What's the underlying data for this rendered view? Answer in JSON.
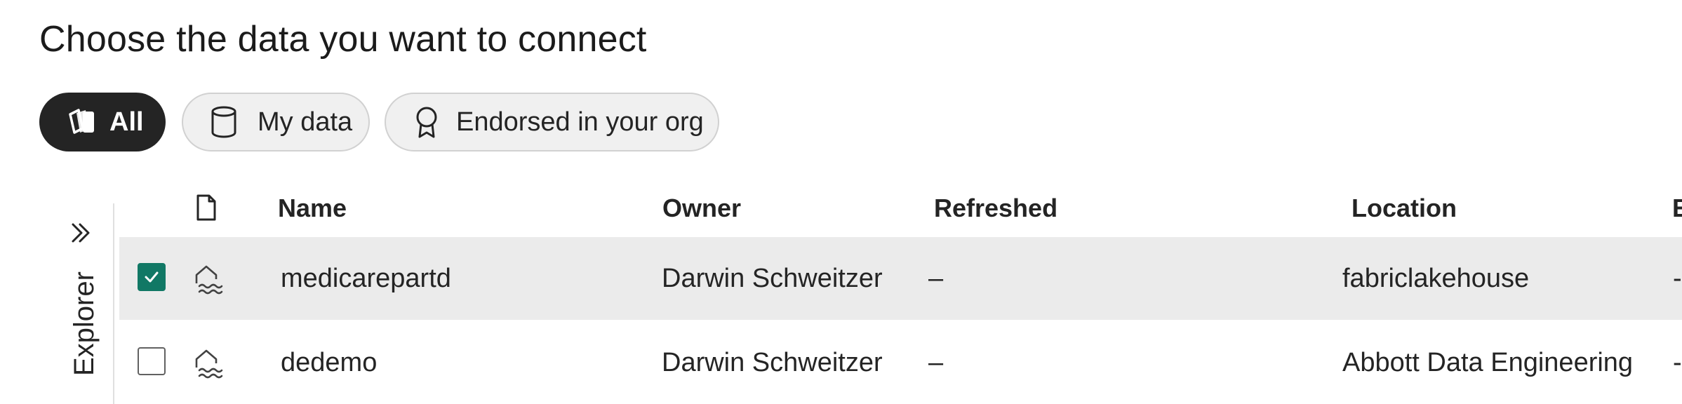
{
  "page": {
    "title": "Choose the data you want to connect"
  },
  "filters": [
    {
      "label": "All",
      "icon": "all-items-icon",
      "active": true
    },
    {
      "label": "My data",
      "icon": "database-icon",
      "active": false
    },
    {
      "label": "Endorsed in your org",
      "icon": "ribbon-award-icon",
      "active": false
    }
  ],
  "explorer": {
    "label": "Explorer",
    "toggle_icon": "chevron-double-right-icon"
  },
  "table": {
    "columns": {
      "type_icon": "file-icon",
      "name": "Name",
      "owner": "Owner",
      "refreshed": "Refreshed",
      "location": "Location",
      "next_col": "E"
    },
    "rows": [
      {
        "selected": true,
        "icon": "lakehouse-icon",
        "name": "medicarepartd",
        "owner": "Darwin Schweitzer",
        "refreshed": "–",
        "location": "fabriclakehouse",
        "next_col": "-"
      },
      {
        "selected": false,
        "icon": "lakehouse-icon",
        "name": "dedemo",
        "owner": "Darwin Schweitzer",
        "refreshed": "–",
        "location": "Abbott Data Engineering",
        "next_col": "-"
      }
    ]
  },
  "colors": {
    "accent_checkbox": "#117865",
    "active_pill": "#242424",
    "selected_row": "#ebebeb"
  }
}
